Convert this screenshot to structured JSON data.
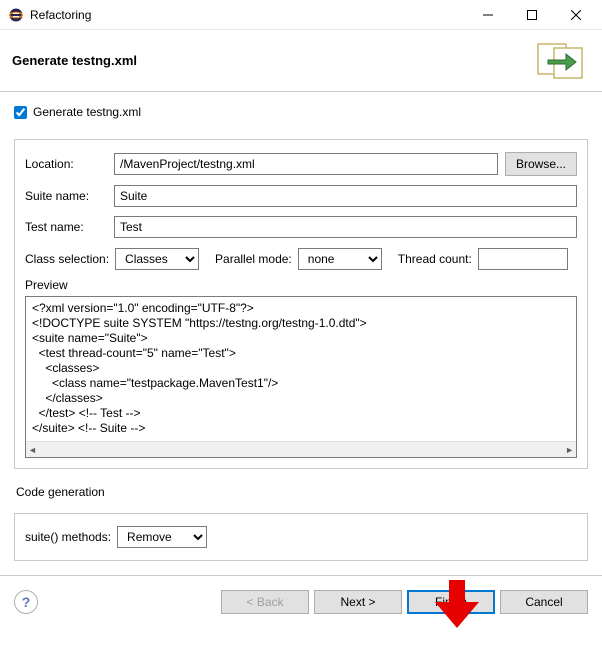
{
  "window": {
    "title": "Refactoring"
  },
  "banner": {
    "heading": "Generate testng.xml"
  },
  "checkbox": {
    "label": "Generate testng.xml",
    "checked": true
  },
  "form": {
    "location": {
      "label": "Location:",
      "value": "/MavenProject/testng.xml",
      "browse": "Browse..."
    },
    "suite_name": {
      "label": "Suite name:",
      "value": "Suite"
    },
    "test_name": {
      "label": "Test name:",
      "value": "Test"
    },
    "class_selection": {
      "label": "Class selection:",
      "value": "Classes"
    },
    "parallel_mode": {
      "label": "Parallel mode:",
      "value": "none"
    },
    "thread_count": {
      "label": "Thread count:",
      "value": ""
    }
  },
  "preview": {
    "label": "Preview",
    "content": "<?xml version=\"1.0\" encoding=\"UTF-8\"?>\n<!DOCTYPE suite SYSTEM \"https://testng.org/testng-1.0.dtd\">\n<suite name=\"Suite\">\n  <test thread-count=\"5\" name=\"Test\">\n    <classes>\n      <class name=\"testpackage.MavenTest1\"/>\n    </classes>\n  </test> <!-- Test -->\n</suite> <!-- Suite -->"
  },
  "codegen": {
    "label": "Code generation",
    "suite_methods": {
      "label": "suite() methods:",
      "value": "Remove"
    }
  },
  "buttons": {
    "back": "< Back",
    "next": "Next >",
    "finish": "Finish",
    "cancel": "Cancel"
  }
}
